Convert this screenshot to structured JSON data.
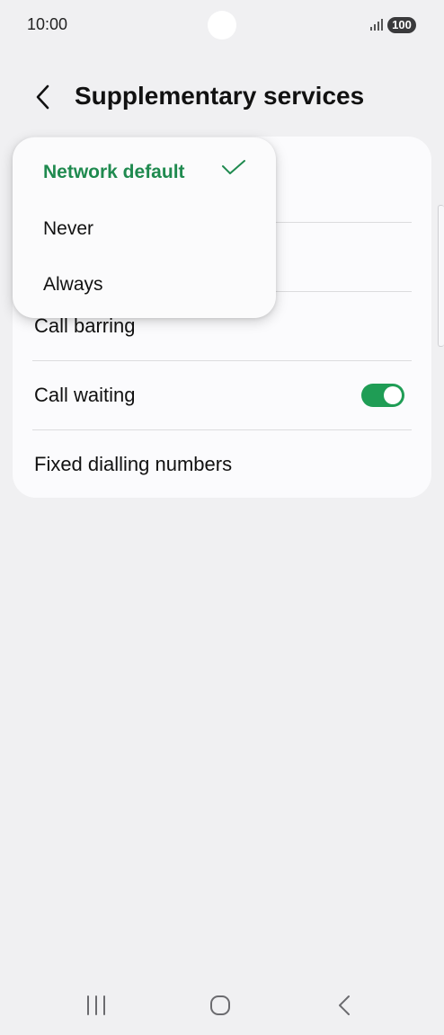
{
  "status_bar": {
    "time": "10:00",
    "battery": "100",
    "signal_icon": "signal-icon"
  },
  "header": {
    "title": "Supplementary services",
    "back_icon": "back-arrow-icon"
  },
  "dropdown": {
    "options": [
      {
        "label": "Network default",
        "selected": true
      },
      {
        "label": "Never",
        "selected": false
      },
      {
        "label": "Always",
        "selected": false
      }
    ],
    "selected_color": "#1f8a4f"
  },
  "settings": {
    "rows": [
      {
        "label": "Call barring"
      },
      {
        "label": "Call waiting",
        "toggle_on": true
      },
      {
        "label": "Fixed dialling numbers"
      }
    ],
    "toggle_color": "#1f9d55"
  },
  "nav_bar": {
    "icons": [
      "recent-apps-icon",
      "home-icon",
      "back-icon"
    ]
  }
}
